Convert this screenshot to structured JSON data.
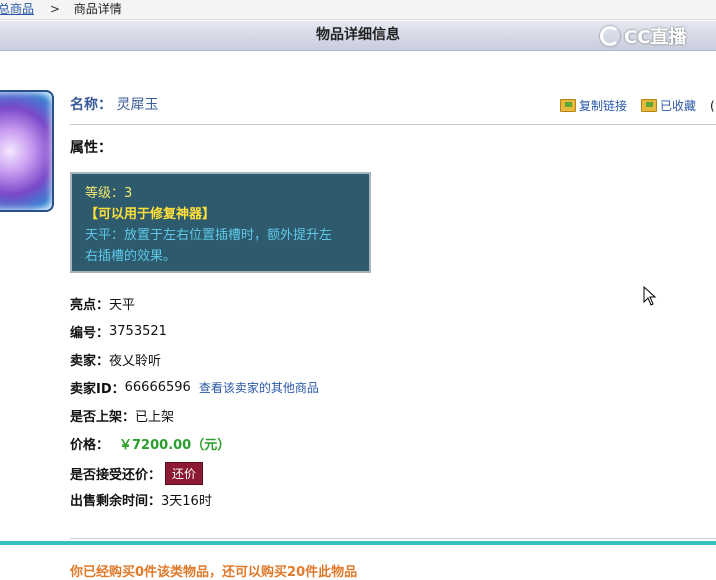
{
  "breadcrumb": {
    "link": "总商品",
    "separator": ">",
    "current": "商品详情"
  },
  "header": {
    "title": "物品详细信息",
    "logo_text": "CC直播"
  },
  "item": {
    "name_label": "名称：",
    "name": "灵犀玉",
    "attr_label": "属性：",
    "attr_lines": [
      "等级：3",
      "【可以用于修复神器】",
      "天平：放置于左右位置插槽时，额外提升左",
      "右插槽的效果。"
    ]
  },
  "actions": {
    "copy_link": "复制链接",
    "favorite": "已收藏",
    "extra": "("
  },
  "fields": {
    "highlight": {
      "label": "亮点：",
      "value": "天平"
    },
    "number": {
      "label": "编号：",
      "value": "3753521"
    },
    "seller": {
      "label": "卖家：",
      "value": "夜乂聆听"
    },
    "seller_id": {
      "label": "卖家ID：",
      "value": "66666596",
      "link": "查看该卖家的其他商品"
    },
    "listed": {
      "label": "是否上架：",
      "value": "已上架"
    },
    "price": {
      "label": "价格：",
      "value": "￥7200.00（元）"
    },
    "counter_offer": {
      "label": "是否接受还价：",
      "button": "还价"
    },
    "time_left": {
      "label": "出售剩余时间：",
      "value": "3天16时"
    }
  },
  "footer": {
    "text": "你已经购买0件该类物品，还可以购买20件此物品"
  },
  "colors": {
    "accent": "#35c2c0",
    "price": "#2a9e2a",
    "button": "#8b1a32",
    "attr_bg": "#2d5a6c"
  }
}
